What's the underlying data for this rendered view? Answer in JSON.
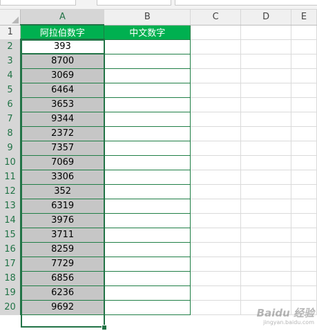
{
  "columns": [
    "A",
    "B",
    "C",
    "D",
    "E"
  ],
  "header_row": {
    "A": "阿拉伯数字",
    "B": "中文数字"
  },
  "row_numbers": [
    "1",
    "2",
    "3",
    "4",
    "5",
    "6",
    "7",
    "8",
    "9",
    "10",
    "11",
    "12",
    "13",
    "14",
    "15",
    "16",
    "17",
    "18",
    "19",
    "20"
  ],
  "arabic_numbers": [
    "393",
    "8700",
    "3069",
    "6464",
    "3653",
    "9344",
    "2372",
    "7357",
    "7069",
    "3306",
    "352",
    "6319",
    "3976",
    "3711",
    "8259",
    "7729",
    "6856",
    "6236",
    "9692"
  ],
  "colors": {
    "header_fill": "#00b050",
    "selection_border": "#217346",
    "selected_fill": "#c6c6c6",
    "watermark": "#787878"
  },
  "watermark": {
    "brand": "Baidu 经验",
    "url": "jingyan.baidu.com"
  }
}
